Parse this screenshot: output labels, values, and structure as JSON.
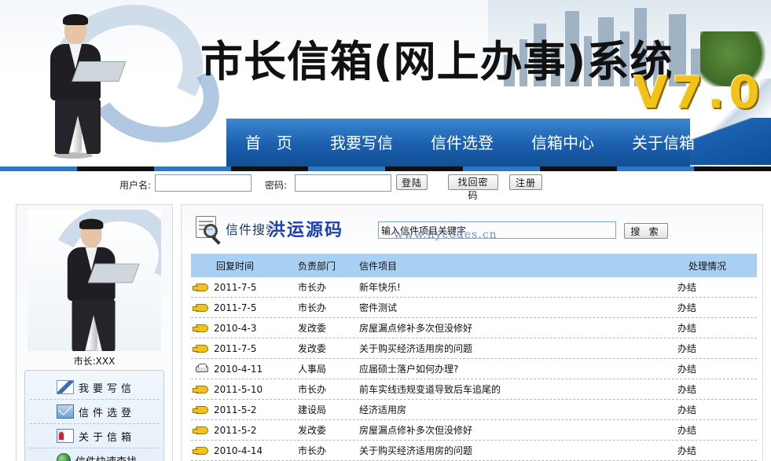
{
  "colors": {
    "nav_top": "#3c86d0",
    "nav_bottom": "#124f95",
    "table_header_bg": "#a9d0f2",
    "version_gold": "#f0c21a",
    "watermark_blue": "#1c3fb8",
    "stripe": [
      "#2d78c4",
      "#111111",
      "#2d78c4",
      "#111111",
      "#2d78c4",
      "#111111",
      "#2d78c4",
      "#111111",
      "#2d78c4",
      "#111111"
    ]
  },
  "header": {
    "title": "市长信箱(网上办事)系统",
    "version": "V7.0"
  },
  "nav": {
    "items": [
      {
        "label": "首　页"
      },
      {
        "label": "我要写信"
      },
      {
        "label": "信件选登"
      },
      {
        "label": "信箱中心"
      },
      {
        "label": "关于信箱"
      }
    ]
  },
  "login": {
    "username_label": "用户名:",
    "username_value": "",
    "password_label": "密码:",
    "password_value": "",
    "login_button": "登陆",
    "recover_button": "找回密码",
    "register_button": "注册"
  },
  "sidebar": {
    "mayor_label": "市长:XXX",
    "menu": [
      {
        "label": "我要写信",
        "icon": "pen-icon"
      },
      {
        "label": "信件选登",
        "icon": "mail-icon"
      },
      {
        "label": "关于信箱",
        "icon": "card-icon"
      },
      {
        "label": "信件快速查找",
        "icon": "globe-icon"
      }
    ]
  },
  "search": {
    "title": "信件搜索",
    "input_value": "输入信件项目关键字",
    "button_label": "搜 索",
    "watermark": "洪运源码",
    "watermark_url": "www.hycodes.cn"
  },
  "table": {
    "headers": {
      "date": "回复时间",
      "dept": "负责部门",
      "item": "信件项目",
      "status": "处理情况"
    },
    "rows": [
      {
        "icon": "hand-pointer-icon",
        "date": "2011-7-5",
        "dept": "市长办",
        "item": "新年快乐!",
        "status": "办结"
      },
      {
        "icon": "hand-pointer-icon",
        "date": "2011-7-5",
        "dept": "市长办",
        "item": "密件测试",
        "status": "办结"
      },
      {
        "icon": "hand-pointer-icon",
        "date": "2010-4-3",
        "dept": "发改委",
        "item": "房屋漏点修补多次但没修好",
        "status": "办结"
      },
      {
        "icon": "hand-pointer-icon",
        "date": "2011-7-5",
        "dept": "发改委",
        "item": "关于购买经济适用房的问题",
        "status": "办结"
      },
      {
        "icon": "car-icon",
        "date": "2010-4-11",
        "dept": "人事局",
        "item": "应届硕士落户如何办理?",
        "status": "办结"
      },
      {
        "icon": "hand-pointer-icon",
        "date": "2011-5-10",
        "dept": "市长办",
        "item": "前车实线违规变道导致后车追尾的",
        "status": "办结"
      },
      {
        "icon": "hand-pointer-icon",
        "date": "2011-5-2",
        "dept": "建设局",
        "item": "经济适用房",
        "status": "办结"
      },
      {
        "icon": "hand-pointer-icon",
        "date": "2011-5-2",
        "dept": "发改委",
        "item": "房屋漏点修补多次但没修好",
        "status": "办结"
      },
      {
        "icon": "hand-pointer-icon",
        "date": "2010-4-14",
        "dept": "市长办",
        "item": "关于购买经济适用房的问题",
        "status": "办结"
      }
    ]
  }
}
